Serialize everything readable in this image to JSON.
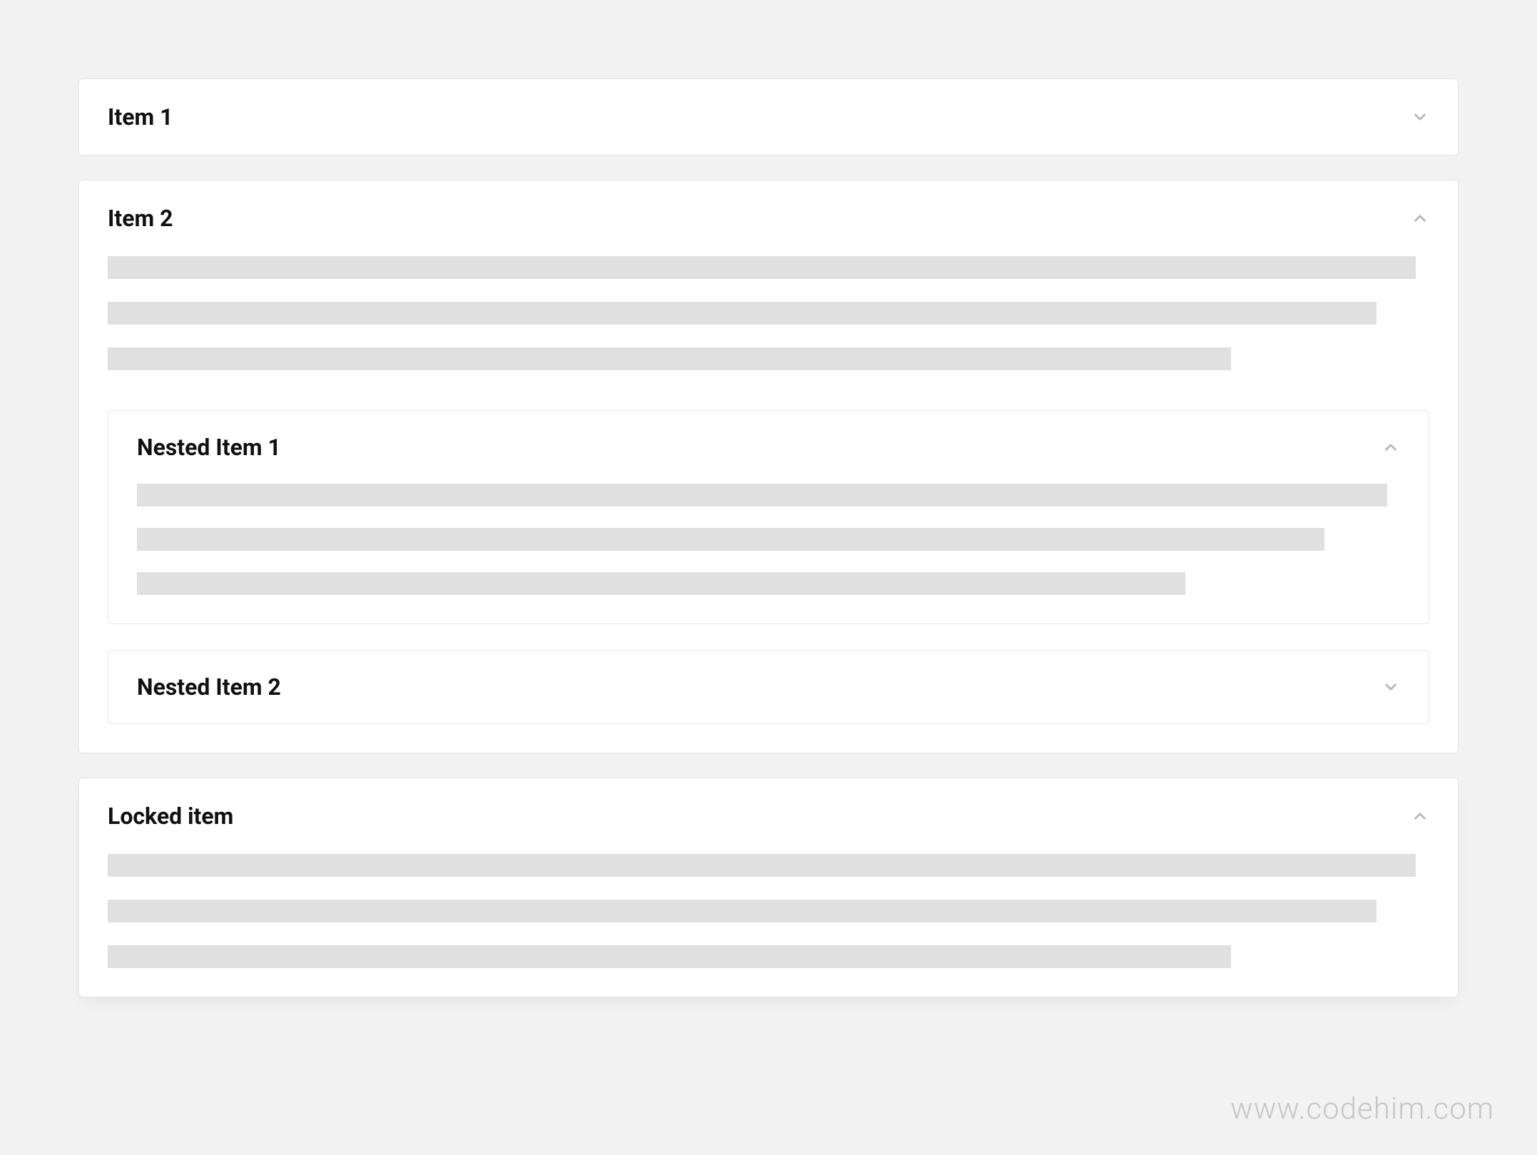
{
  "accordion": {
    "items": [
      {
        "label": "Item 1",
        "expanded": false,
        "nested": []
      },
      {
        "label": "Item 2",
        "expanded": true,
        "nested": [
          {
            "label": "Nested Item 1",
            "expanded": true
          },
          {
            "label": "Nested Item 2",
            "expanded": false
          }
        ]
      },
      {
        "label": "Locked item",
        "expanded": true,
        "nested": []
      }
    ]
  },
  "watermark": "www.codehim.com"
}
